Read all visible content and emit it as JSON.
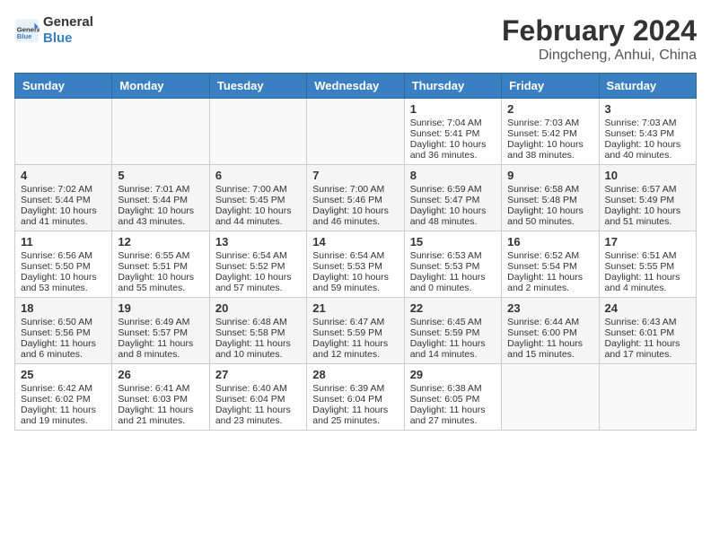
{
  "logo": {
    "text_general": "General",
    "text_blue": "Blue"
  },
  "title": "February 2024",
  "subtitle": "Dingcheng, Anhui, China",
  "weekdays": [
    "Sunday",
    "Monday",
    "Tuesday",
    "Wednesday",
    "Thursday",
    "Friday",
    "Saturday"
  ],
  "weeks": [
    [
      {
        "day": "",
        "info": ""
      },
      {
        "day": "",
        "info": ""
      },
      {
        "day": "",
        "info": ""
      },
      {
        "day": "",
        "info": ""
      },
      {
        "day": "1",
        "info": "Sunrise: 7:04 AM\nSunset: 5:41 PM\nDaylight: 10 hours\nand 36 minutes."
      },
      {
        "day": "2",
        "info": "Sunrise: 7:03 AM\nSunset: 5:42 PM\nDaylight: 10 hours\nand 38 minutes."
      },
      {
        "day": "3",
        "info": "Sunrise: 7:03 AM\nSunset: 5:43 PM\nDaylight: 10 hours\nand 40 minutes."
      }
    ],
    [
      {
        "day": "4",
        "info": "Sunrise: 7:02 AM\nSunset: 5:44 PM\nDaylight: 10 hours\nand 41 minutes."
      },
      {
        "day": "5",
        "info": "Sunrise: 7:01 AM\nSunset: 5:44 PM\nDaylight: 10 hours\nand 43 minutes."
      },
      {
        "day": "6",
        "info": "Sunrise: 7:00 AM\nSunset: 5:45 PM\nDaylight: 10 hours\nand 44 minutes."
      },
      {
        "day": "7",
        "info": "Sunrise: 7:00 AM\nSunset: 5:46 PM\nDaylight: 10 hours\nand 46 minutes."
      },
      {
        "day": "8",
        "info": "Sunrise: 6:59 AM\nSunset: 5:47 PM\nDaylight: 10 hours\nand 48 minutes."
      },
      {
        "day": "9",
        "info": "Sunrise: 6:58 AM\nSunset: 5:48 PM\nDaylight: 10 hours\nand 50 minutes."
      },
      {
        "day": "10",
        "info": "Sunrise: 6:57 AM\nSunset: 5:49 PM\nDaylight: 10 hours\nand 51 minutes."
      }
    ],
    [
      {
        "day": "11",
        "info": "Sunrise: 6:56 AM\nSunset: 5:50 PM\nDaylight: 10 hours\nand 53 minutes."
      },
      {
        "day": "12",
        "info": "Sunrise: 6:55 AM\nSunset: 5:51 PM\nDaylight: 10 hours\nand 55 minutes."
      },
      {
        "day": "13",
        "info": "Sunrise: 6:54 AM\nSunset: 5:52 PM\nDaylight: 10 hours\nand 57 minutes."
      },
      {
        "day": "14",
        "info": "Sunrise: 6:54 AM\nSunset: 5:53 PM\nDaylight: 10 hours\nand 59 minutes."
      },
      {
        "day": "15",
        "info": "Sunrise: 6:53 AM\nSunset: 5:53 PM\nDaylight: 11 hours\nand 0 minutes."
      },
      {
        "day": "16",
        "info": "Sunrise: 6:52 AM\nSunset: 5:54 PM\nDaylight: 11 hours\nand 2 minutes."
      },
      {
        "day": "17",
        "info": "Sunrise: 6:51 AM\nSunset: 5:55 PM\nDaylight: 11 hours\nand 4 minutes."
      }
    ],
    [
      {
        "day": "18",
        "info": "Sunrise: 6:50 AM\nSunset: 5:56 PM\nDaylight: 11 hours\nand 6 minutes."
      },
      {
        "day": "19",
        "info": "Sunrise: 6:49 AM\nSunset: 5:57 PM\nDaylight: 11 hours\nand 8 minutes."
      },
      {
        "day": "20",
        "info": "Sunrise: 6:48 AM\nSunset: 5:58 PM\nDaylight: 11 hours\nand 10 minutes."
      },
      {
        "day": "21",
        "info": "Sunrise: 6:47 AM\nSunset: 5:59 PM\nDaylight: 11 hours\nand 12 minutes."
      },
      {
        "day": "22",
        "info": "Sunrise: 6:45 AM\nSunset: 5:59 PM\nDaylight: 11 hours\nand 14 minutes."
      },
      {
        "day": "23",
        "info": "Sunrise: 6:44 AM\nSunset: 6:00 PM\nDaylight: 11 hours\nand 15 minutes."
      },
      {
        "day": "24",
        "info": "Sunrise: 6:43 AM\nSunset: 6:01 PM\nDaylight: 11 hours\nand 17 minutes."
      }
    ],
    [
      {
        "day": "25",
        "info": "Sunrise: 6:42 AM\nSunset: 6:02 PM\nDaylight: 11 hours\nand 19 minutes."
      },
      {
        "day": "26",
        "info": "Sunrise: 6:41 AM\nSunset: 6:03 PM\nDaylight: 11 hours\nand 21 minutes."
      },
      {
        "day": "27",
        "info": "Sunrise: 6:40 AM\nSunset: 6:04 PM\nDaylight: 11 hours\nand 23 minutes."
      },
      {
        "day": "28",
        "info": "Sunrise: 6:39 AM\nSunset: 6:04 PM\nDaylight: 11 hours\nand 25 minutes."
      },
      {
        "day": "29",
        "info": "Sunrise: 6:38 AM\nSunset: 6:05 PM\nDaylight: 11 hours\nand 27 minutes."
      },
      {
        "day": "",
        "info": ""
      },
      {
        "day": "",
        "info": ""
      }
    ]
  ]
}
